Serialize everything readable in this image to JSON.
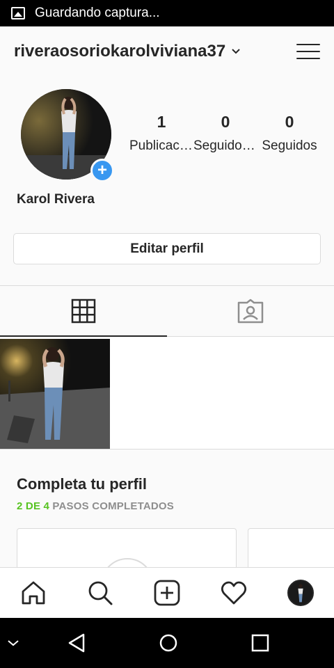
{
  "status_bar": {
    "text": "Guardando captura...",
    "icon": "image-icon"
  },
  "header": {
    "username": "riveraosoriokarolviviana37",
    "dropdown_icon": "chevron-down-icon",
    "menu_icon": "hamburger-menu-icon"
  },
  "profile": {
    "full_name": "Karol Rivera",
    "add_icon": "+",
    "stats": [
      {
        "value": "1",
        "label": "Publicaciones"
      },
      {
        "value": "0",
        "label": "Seguidores"
      },
      {
        "value": "0",
        "label": "Seguidos"
      }
    ],
    "edit_button": "Editar perfil"
  },
  "tabs": [
    {
      "name": "grid",
      "icon": "grid-icon",
      "active": true
    },
    {
      "name": "tagged",
      "icon": "tagged-photos-icon",
      "active": false
    }
  ],
  "complete_profile": {
    "title": "Completa tu perfil",
    "progress_done": "2 DE 4",
    "progress_text": " PASOS COMPLETADOS"
  },
  "bottom_nav": [
    {
      "name": "home",
      "icon": "home-icon"
    },
    {
      "name": "search",
      "icon": "search-icon"
    },
    {
      "name": "new-post",
      "icon": "add-post-icon"
    },
    {
      "name": "activity",
      "icon": "heart-icon"
    },
    {
      "name": "profile",
      "icon": "avatar"
    }
  ],
  "colors": {
    "accent_blue": "#3897f0",
    "progress_green": "#58c322",
    "text": "#262626",
    "muted": "#8e8e8e",
    "border": "#dbdbdb"
  }
}
